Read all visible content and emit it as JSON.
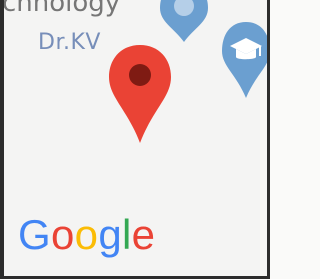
{
  "map": {
    "labels": {
      "top": "chnology",
      "drkv": "Dr.KV"
    },
    "pin": {
      "icon": "map-marker-icon",
      "color": "#ea4335",
      "dot": "#7f1b13"
    },
    "poi_icons": {
      "top": "place-icon",
      "education": "graduation-cap-icon",
      "color": "#6b9fd0"
    },
    "logo": {
      "letters": [
        "G",
        "o",
        "o",
        "g",
        "l",
        "e"
      ],
      "colors": [
        "#4285F4",
        "#EA4335",
        "#FBBC05",
        "#4285F4",
        "#34A853",
        "#EA4335"
      ]
    }
  }
}
